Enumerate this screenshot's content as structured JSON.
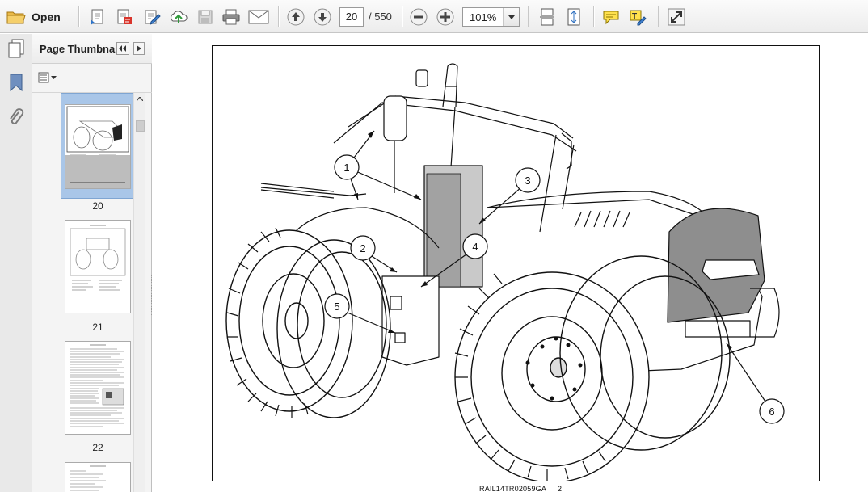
{
  "toolbar": {
    "open_label": "Open",
    "current_page": "20",
    "page_total": "/ 550",
    "zoom": "101%"
  },
  "panel": {
    "title": "Page Thumbna..."
  },
  "thumbnails": [
    {
      "label": "20",
      "selected": true
    },
    {
      "label": "21",
      "selected": false
    },
    {
      "label": "22",
      "selected": false
    },
    {
      "label": "",
      "selected": false
    }
  ],
  "figure": {
    "callouts": [
      "1",
      "2",
      "3",
      "4",
      "5",
      "6"
    ],
    "caption_code": "RAIL14TR02059GA",
    "page_number": "2"
  }
}
